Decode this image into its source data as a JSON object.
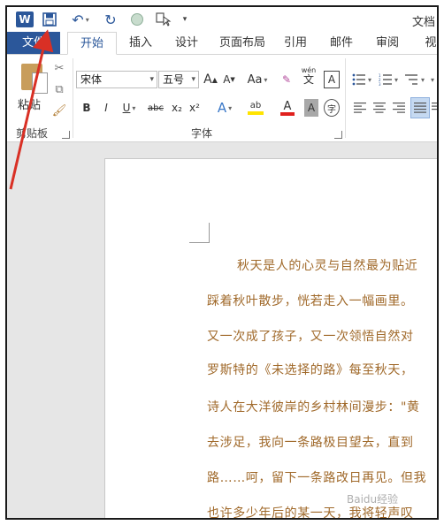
{
  "titlebar": {
    "app_icon": "W",
    "doc_title": "文档",
    "icons": [
      "word-app-icon",
      "save-icon",
      "undo-icon",
      "redo-icon",
      "circle-icon",
      "touch-mode-icon",
      "customize-qat-icon"
    ]
  },
  "tabs": [
    {
      "label": "文件"
    },
    {
      "label": "开始"
    },
    {
      "label": "插入"
    },
    {
      "label": "设计"
    },
    {
      "label": "页面布局"
    },
    {
      "label": "引用"
    },
    {
      "label": "邮件"
    },
    {
      "label": "审阅"
    },
    {
      "label": "视"
    }
  ],
  "clipboard": {
    "paste_label": "粘贴",
    "group_label": "剪贴板"
  },
  "font": {
    "name": "宋体",
    "size": "五号",
    "group_label": "字体",
    "grow": "A",
    "shrink": "A",
    "case": "Aa",
    "clear_format_icon": "✎",
    "phonetic": "wén",
    "phonetic_char": "文",
    "border_char": "A",
    "bold": "B",
    "italic": "I",
    "underline": "U",
    "strike": "abc",
    "subscript": "x₂",
    "superscript": "x²",
    "effects": "A",
    "highlight": "ab",
    "font_color": "A",
    "shading": "A",
    "enclose": "字"
  },
  "colors": {
    "accent": "#2b579a",
    "text_brown": "#a0692a",
    "arrow": "#d93025",
    "highlight_yellow": "#ffe400",
    "font_red": "#e0201d"
  },
  "document": {
    "paragraphs": [
      "秋天是人的心灵与自然最为贴近",
      "踩着秋叶散步，恍若走入一幅画里。",
      "又一次成了孩子，又一次领悟自然对",
      "罗斯特的《未选择的路》每至秋天，",
      "诗人在大洋彼岸的乡村林间漫步：\"黄",
      "去涉足，我向一条路极目望去，直到",
      "路……呵，留下一条路改日再见。但我",
      "也许多少年后的某一天，我将轻声叹"
    ]
  },
  "watermark": "Baidu经验"
}
